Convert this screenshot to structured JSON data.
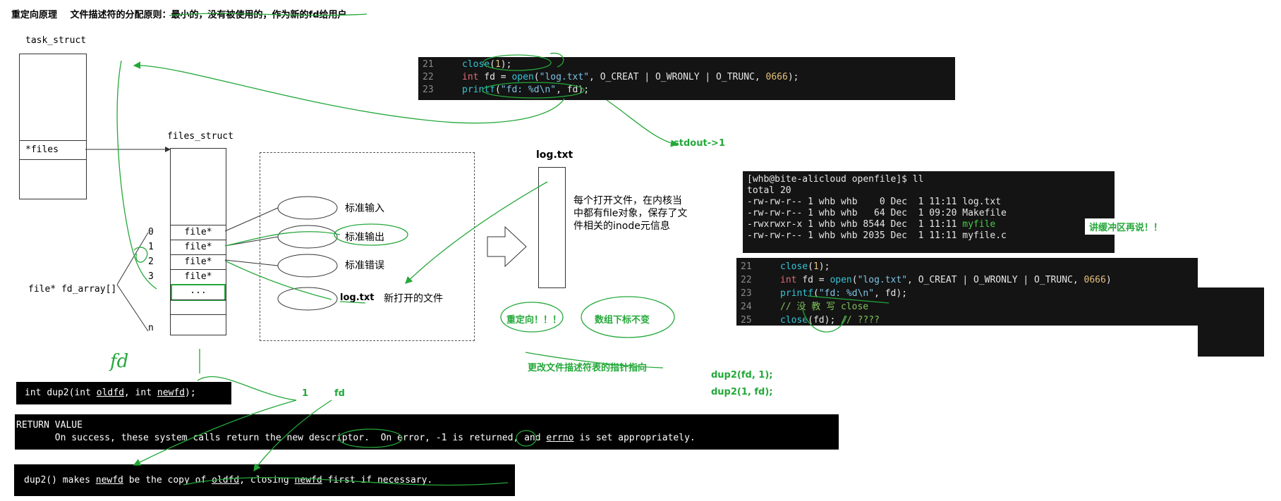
{
  "title": {
    "part1": "重定向原理",
    "part2": "文件描述符的分配原则：最小的，没有被使用的，作为新的fd给用户"
  },
  "task_struct": {
    "label": "task_struct",
    "files_field": "*files"
  },
  "files_struct": {
    "label": "files_struct",
    "cells": [
      "file*",
      "file*",
      "file*",
      "file*",
      "..."
    ],
    "indices": [
      "0",
      "1",
      "2",
      "3",
      "n"
    ]
  },
  "fd_array_label": "file* fd_array[]",
  "streams": {
    "stdin": "标准输入",
    "stdout": "标准输出",
    "stderr": "标准错误",
    "logfile": "log.txt",
    "logfile_desc": "新打开的文件"
  },
  "logtxt_box": {
    "title": "log.txt",
    "desc": "每个打开文件，在内核当中都有file对象，保存了文件相关的inode元信息"
  },
  "code_top": [
    {
      "ln": "21",
      "parts": [
        {
          "t": "close",
          "c": "fn"
        },
        {
          "t": "(",
          "c": ""
        },
        {
          "t": "1",
          "c": "num"
        },
        {
          "t": ");",
          "c": ""
        }
      ]
    },
    {
      "ln": "22",
      "parts": [
        {
          "t": "int",
          "c": "kw"
        },
        {
          "t": " fd = ",
          "c": ""
        },
        {
          "t": "open",
          "c": "fn"
        },
        {
          "t": "(",
          "c": ""
        },
        {
          "t": "\"log.txt\"",
          "c": "str"
        },
        {
          "t": ", O_CREAT | O_WRONLY | O_TRUNC, ",
          "c": ""
        },
        {
          "t": "0666",
          "c": "num"
        },
        {
          "t": ");",
          "c": ""
        }
      ]
    },
    {
      "ln": "23",
      "parts": [
        {
          "t": "printf",
          "c": "fn"
        },
        {
          "t": "(",
          "c": ""
        },
        {
          "t": "\"fd: %d\\n\"",
          "c": "str"
        },
        {
          "t": ", fd);",
          "c": ""
        }
      ]
    }
  ],
  "notes": {
    "stdout_to_1": "stdout->1",
    "buffer_later": "讲缓冲区再说！！",
    "redirect": "重定向！！！",
    "index_unchanged": "数组下标不变",
    "change_pointer": "更改文件描述符表的指针指向",
    "dup_a": "dup2(fd, 1);",
    "dup_b": "dup2(1, fd);",
    "one": "1",
    "fd": "fd",
    "fd_hand": "fd"
  },
  "terminal": {
    "prompt": "[whb@bite-alicloud openfile]$ ll",
    "total": "total 20",
    "rows": [
      {
        "perm": "-rw-rw-r-- 1 whb whb    ",
        "size": "0",
        "date": " Dec  1 11:11 ",
        "name": "log.txt",
        "exec": false
      },
      {
        "perm": "-rw-rw-r-- 1 whb whb   ",
        "size": "64",
        "date": " Dec  1 09:20 ",
        "name": "Makefile",
        "exec": false
      },
      {
        "perm": "-rwxrwxr-x 1 whb whb ",
        "size": "8544",
        "date": " Dec  1 11:11 ",
        "name": "myfile",
        "exec": true
      },
      {
        "perm": "-rw-rw-r-- 1 whb whb ",
        "size": "2035",
        "date": " Dec  1 11:11 ",
        "name": "myfile.c",
        "exec": false
      }
    ]
  },
  "code_bottom": [
    {
      "ln": "21",
      "parts": [
        {
          "t": "close",
          "c": "fn"
        },
        {
          "t": "(",
          "c": ""
        },
        {
          "t": "1",
          "c": "num"
        },
        {
          "t": ");",
          "c": ""
        }
      ]
    },
    {
      "ln": "22",
      "parts": [
        {
          "t": "int",
          "c": "kw"
        },
        {
          "t": " fd = ",
          "c": ""
        },
        {
          "t": "open",
          "c": "fn"
        },
        {
          "t": "(",
          "c": ""
        },
        {
          "t": "\"log.txt\"",
          "c": "str"
        },
        {
          "t": ", O_CREAT | O_WRONLY | O_TRUNC, ",
          "c": ""
        },
        {
          "t": "0666",
          "c": "num"
        },
        {
          "t": ")",
          "c": ""
        }
      ]
    },
    {
      "ln": "23",
      "parts": [
        {
          "t": "printf",
          "c": "fn"
        },
        {
          "t": "(",
          "c": ""
        },
        {
          "t": "\"fd: %d\\n\"",
          "c": "str"
        },
        {
          "t": ", fd);",
          "c": ""
        }
      ]
    },
    {
      "ln": "24",
      "parts": [
        {
          "t": "// 没 教 写 close",
          "c": "com"
        }
      ]
    },
    {
      "ln": "25",
      "parts": [
        {
          "t": "close",
          "c": "fn"
        },
        {
          "t": "(fd); ",
          "c": ""
        },
        {
          "t": "// ????",
          "c": "com"
        }
      ]
    }
  ],
  "dup2_sig": {
    "pre": "int ",
    "fn": "dup2",
    "mid": "(int ",
    "a1": "oldfd",
    "sep": ", int ",
    "a2": "newfd",
    "end": ");"
  },
  "return_value": {
    "header": "RETURN VALUE",
    "l1": "       On success, these system calls return the ",
    "l2": "new descriptor",
    "l3": ".  On error, ",
    "l4": "-1",
    "l5": " is returned, and ",
    "l6": "errno",
    "l7": " is set appropriately."
  },
  "dup2_desc": {
    "p1": "dup2() makes ",
    "a": "newfd",
    "p2": " be the copy of ",
    "b": "oldfd",
    "p3": ", closing ",
    "c": "newfd",
    "p4": " first if necessary."
  },
  "colors": {
    "ink": "#24a83a",
    "term_bg": "#141414"
  }
}
